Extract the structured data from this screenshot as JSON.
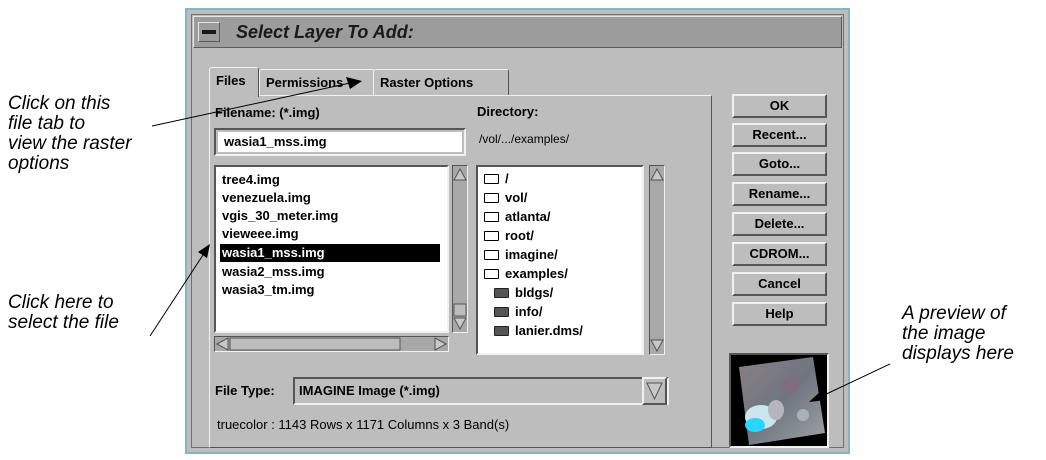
{
  "dialog": {
    "title": "Select Layer To Add:",
    "tabs": [
      {
        "label": "Files",
        "active": true
      },
      {
        "label": "Permissions",
        "active": false
      },
      {
        "label": "Raster Options",
        "active": false
      }
    ],
    "filename_label": "Filename: (*.img)",
    "filename_value": "wasia1_mss.img",
    "directory_label": "Directory:",
    "directory_path": "/vol/.../examples/",
    "files": [
      "tree4.img",
      "venezuela.img",
      "vgis_30_meter.img",
      "vieweee.img",
      "wasia1_mss.img",
      "wasia2_mss.img",
      "wasia3_tm.img"
    ],
    "selected_file_index": 4,
    "directories": [
      {
        "name": "/",
        "icon": "open-folder-icon"
      },
      {
        "name": "vol/",
        "icon": "open-folder-icon"
      },
      {
        "name": "atlanta/",
        "icon": "open-folder-icon"
      },
      {
        "name": "root/",
        "icon": "open-folder-icon"
      },
      {
        "name": "imagine/",
        "icon": "open-folder-icon"
      },
      {
        "name": "examples/",
        "icon": "open-folder-icon"
      },
      {
        "name": "bldgs/",
        "icon": "closed-folder-icon"
      },
      {
        "name": "info/",
        "icon": "closed-folder-icon"
      },
      {
        "name": "lanier.dms/",
        "icon": "closed-folder-icon"
      }
    ],
    "file_type_label": "File Type:",
    "file_type_value": "IMAGINE Image (*.img)",
    "status": "truecolor : 1143 Rows x 1171 Columns x 3 Band(s)",
    "buttons": {
      "ok": "OK",
      "recent": "Recent...",
      "goto": "Goto...",
      "rename": "Rename...",
      "delete": "Delete...",
      "cdrom": "CDROM...",
      "cancel": "Cancel",
      "help": "Help"
    }
  },
  "annotations": {
    "tab_note": [
      "Click on this",
      "file tab to",
      "view the raster",
      "options"
    ],
    "file_note": [
      "Click here to",
      "select the file"
    ],
    "preview_note": [
      "A preview of",
      "the image",
      "displays here"
    ]
  },
  "colors": {
    "dialog_bg": "#bdbdbd",
    "titlebar_bg": "#9c9c9c",
    "outer_border": "#7fb8c0",
    "selection_bg": "#000000"
  }
}
